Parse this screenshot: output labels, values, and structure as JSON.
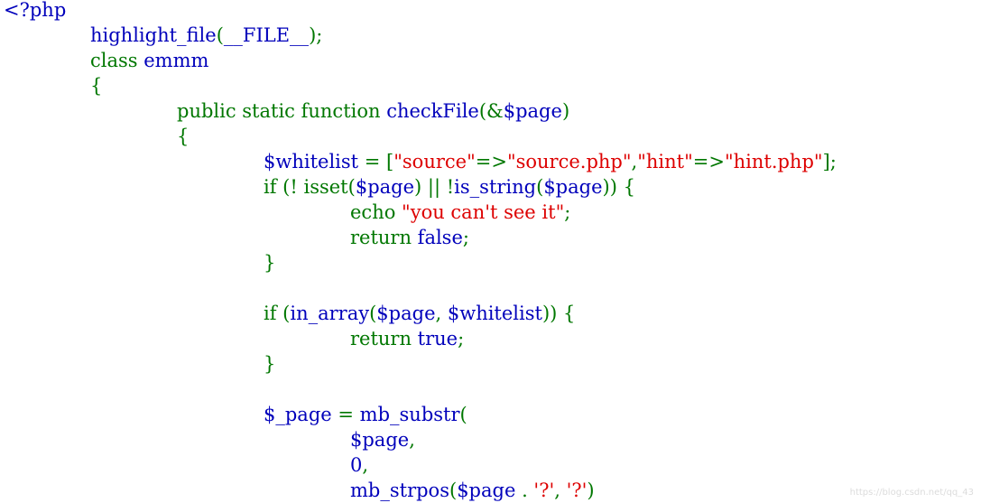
{
  "colors": {
    "default": "#0000BB",
    "keyword": "#007700",
    "string": "#DD0000",
    "watermark": "#dcdcdc"
  },
  "watermark": "https://blog.csdn.net/qq_43",
  "lines": [
    {
      "tokens": [
        {
          "t": "<?php",
          "c": "default"
        }
      ]
    },
    {
      "tokens": [
        {
          "t": "highlight_file",
          "c": "default"
        },
        {
          "t": "(",
          "c": "keyword"
        },
        {
          "t": "__FILE__",
          "c": "default"
        },
        {
          "t": ");",
          "c": "keyword"
        }
      ]
    },
    {
      "tokens": [
        {
          "t": "class ",
          "c": "keyword"
        },
        {
          "t": "emmm",
          "c": "default"
        }
      ]
    },
    {
      "tokens": [
        {
          "t": "{",
          "c": "keyword"
        }
      ]
    },
    {
      "tokens": [
        {
          "t": "public static function ",
          "c": "keyword"
        },
        {
          "t": "checkFile",
          "c": "default"
        },
        {
          "t": "(&",
          "c": "keyword"
        },
        {
          "t": "$page",
          "c": "default"
        },
        {
          "t": ")",
          "c": "keyword"
        }
      ]
    },
    {
      "tokens": [
        {
          "t": "{",
          "c": "keyword"
        }
      ]
    },
    {
      "tokens": [
        {
          "t": "$whitelist ",
          "c": "default"
        },
        {
          "t": "= [",
          "c": "keyword"
        },
        {
          "t": "\"source\"",
          "c": "string"
        },
        {
          "t": "=>",
          "c": "keyword"
        },
        {
          "t": "\"source.php\"",
          "c": "string"
        },
        {
          "t": ",",
          "c": "keyword"
        },
        {
          "t": "\"hint\"",
          "c": "string"
        },
        {
          "t": "=>",
          "c": "keyword"
        },
        {
          "t": "\"hint.php\"",
          "c": "string"
        },
        {
          "t": "];",
          "c": "keyword"
        }
      ]
    },
    {
      "tokens": [
        {
          "t": "if (! ",
          "c": "keyword"
        },
        {
          "t": "isset",
          "c": "keyword"
        },
        {
          "t": "(",
          "c": "keyword"
        },
        {
          "t": "$page",
          "c": "default"
        },
        {
          "t": ") || !",
          "c": "keyword"
        },
        {
          "t": "is_string",
          "c": "default"
        },
        {
          "t": "(",
          "c": "keyword"
        },
        {
          "t": "$page",
          "c": "default"
        },
        {
          "t": ")) {",
          "c": "keyword"
        }
      ]
    },
    {
      "tokens": [
        {
          "t": "echo ",
          "c": "keyword"
        },
        {
          "t": "\"you can't see it\"",
          "c": "string"
        },
        {
          "t": ";",
          "c": "keyword"
        }
      ]
    },
    {
      "tokens": [
        {
          "t": "return ",
          "c": "keyword"
        },
        {
          "t": "false",
          "c": "default"
        },
        {
          "t": ";",
          "c": "keyword"
        }
      ]
    },
    {
      "tokens": [
        {
          "t": "}",
          "c": "keyword"
        }
      ]
    },
    {
      "tokens": []
    },
    {
      "tokens": [
        {
          "t": "if (",
          "c": "keyword"
        },
        {
          "t": "in_array",
          "c": "default"
        },
        {
          "t": "(",
          "c": "keyword"
        },
        {
          "t": "$page",
          "c": "default"
        },
        {
          "t": ", ",
          "c": "keyword"
        },
        {
          "t": "$whitelist",
          "c": "default"
        },
        {
          "t": ")) {",
          "c": "keyword"
        }
      ]
    },
    {
      "tokens": [
        {
          "t": "return ",
          "c": "keyword"
        },
        {
          "t": "true",
          "c": "default"
        },
        {
          "t": ";",
          "c": "keyword"
        }
      ]
    },
    {
      "tokens": [
        {
          "t": "}",
          "c": "keyword"
        }
      ]
    },
    {
      "tokens": []
    },
    {
      "tokens": [
        {
          "t": "$_page ",
          "c": "default"
        },
        {
          "t": "= ",
          "c": "keyword"
        },
        {
          "t": "mb_substr",
          "c": "default"
        },
        {
          "t": "(",
          "c": "keyword"
        }
      ]
    },
    {
      "tokens": [
        {
          "t": "$page",
          "c": "default"
        },
        {
          "t": ",",
          "c": "keyword"
        }
      ]
    },
    {
      "tokens": [
        {
          "t": "0",
          "c": "default"
        },
        {
          "t": ",",
          "c": "keyword"
        }
      ]
    },
    {
      "tokens": [
        {
          "t": "mb_strpos",
          "c": "default"
        },
        {
          "t": "(",
          "c": "keyword"
        },
        {
          "t": "$page ",
          "c": "default"
        },
        {
          "t": ". ",
          "c": "keyword"
        },
        {
          "t": "'?'",
          "c": "string"
        },
        {
          "t": ", ",
          "c": "keyword"
        },
        {
          "t": "'?'",
          "c": "string"
        },
        {
          "t": ")",
          "c": "keyword"
        }
      ]
    }
  ]
}
